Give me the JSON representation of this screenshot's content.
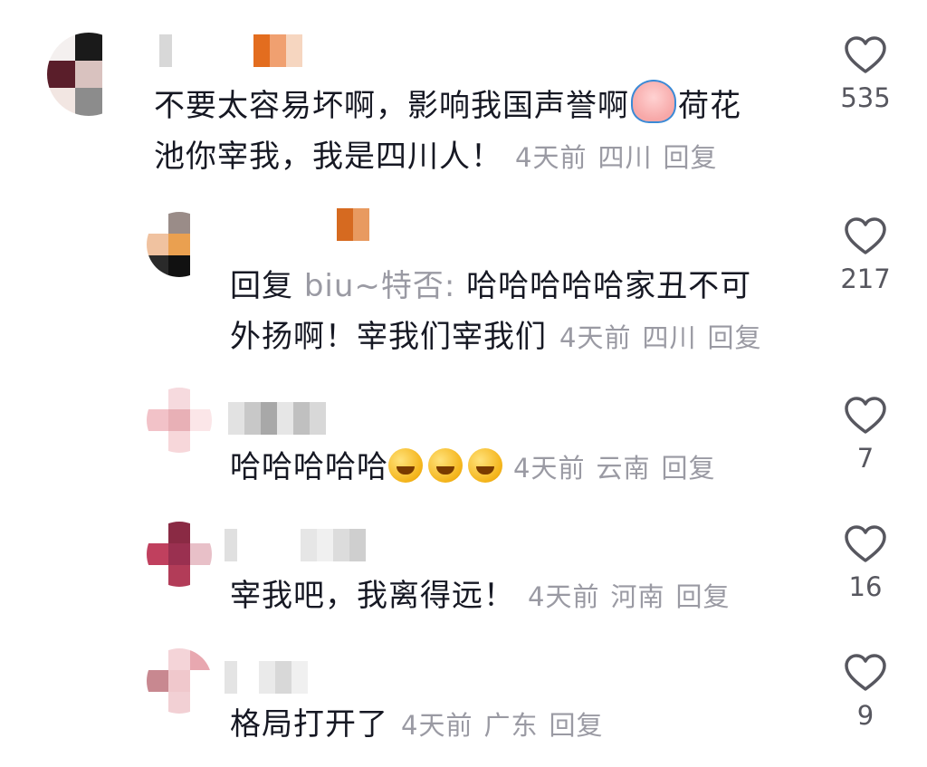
{
  "comments": [
    {
      "text": "不要太容易坏啊，影响我国声誉啊",
      "text2": "荷花",
      "line2": "池你宰我，我是四川人！",
      "time": "4天前",
      "location": "四川",
      "reply": "回复",
      "likes": "535"
    },
    {
      "reply_prefix": "回复",
      "reply_to": "biu~特否:",
      "text": "哈哈哈哈哈家丑不可",
      "line2": "外扬啊！宰我们宰我们",
      "time": "4天前",
      "location": "四川",
      "reply": "回复",
      "likes": "217"
    },
    {
      "text": "哈哈哈哈哈",
      "time": "4天前",
      "location": "云南",
      "reply": "回复",
      "likes": "7"
    },
    {
      "text": "宰我吧，我离得远！",
      "time": "4天前",
      "location": "河南",
      "reply": "回复",
      "likes": "16"
    },
    {
      "text": "格局打开了",
      "time": "4天前",
      "location": "广东",
      "reply": "回复",
      "likes": "9"
    }
  ],
  "colors": {
    "meta": "#9a9aa3",
    "text": "#161823",
    "heart_stroke": "#57575f"
  },
  "icons": {
    "like": "heart-outline-icon",
    "emoji_laugh": "rofl-emoji-icon",
    "emoji_cry": "crying-emoji-icon"
  }
}
